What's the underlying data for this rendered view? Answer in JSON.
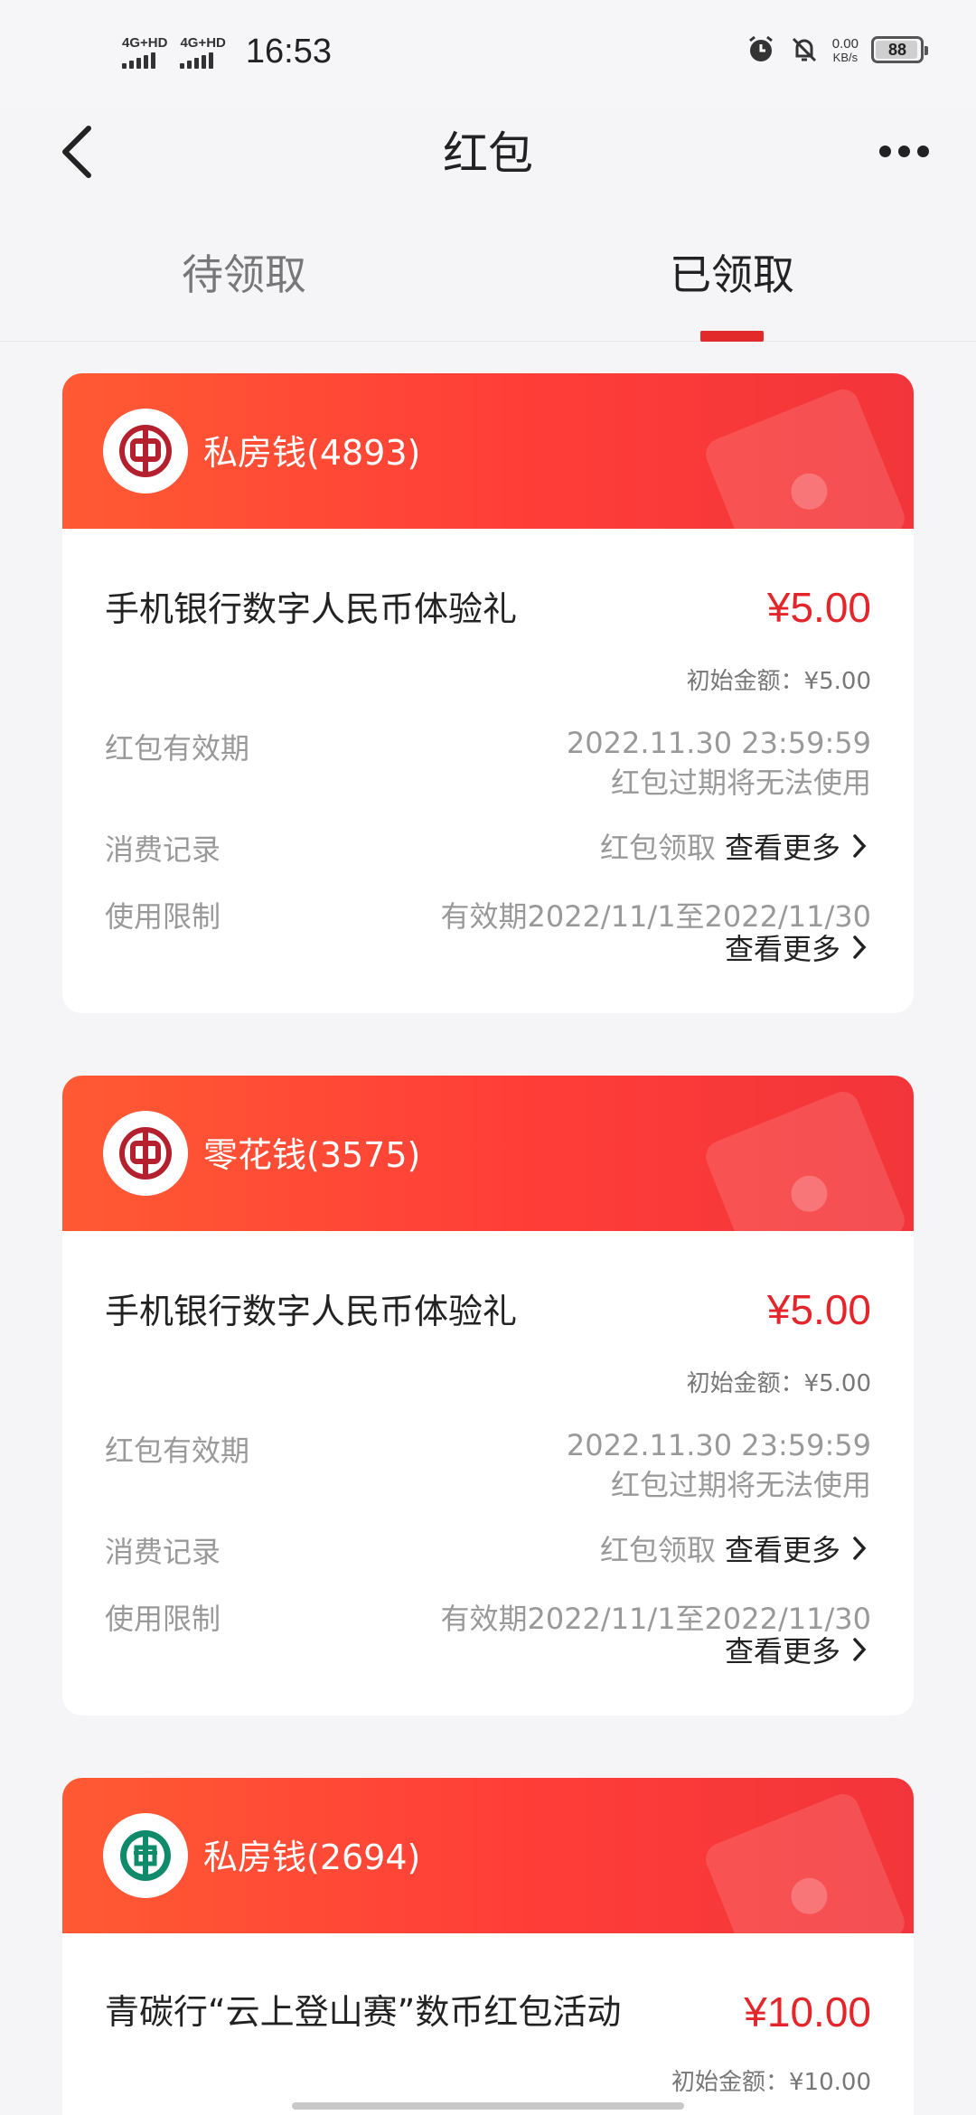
{
  "status_bar": {
    "network_1": "4G+HD",
    "network_2": "4G+HD",
    "time": "16:53",
    "speed_value": "0.00",
    "speed_unit": "KB/s",
    "battery": "88",
    "battery_level_percent": 88,
    "icons": [
      "alarm-icon",
      "mute-bell-icon"
    ]
  },
  "nav": {
    "title": "红包",
    "back_icon": "chevron-left-icon",
    "more_icon": "more-dots-icon"
  },
  "tabs": [
    {
      "label": "待领取",
      "active": false
    },
    {
      "label": "已领取",
      "active": true
    }
  ],
  "accent_color": "#e3262b",
  "cards": [
    {
      "logo_icon": "bank-of-china-logo",
      "header_label": "私房钱(4893)",
      "name": "手机银行数字人民币体验礼",
      "amount": "¥5.00",
      "initial_amount": "初始金额：¥5.00",
      "validity_label": "红包有效期",
      "validity_value": "2022.11.30 23:59:59",
      "validity_note": "红包过期将无法使用",
      "record_label": "消费记录",
      "record_value": "红包领取",
      "record_link": "查看更多",
      "limit_label": "使用限制",
      "limit_value": "有效期2022/11/1至2022/11/30",
      "limit_link": "查看更多"
    },
    {
      "logo_icon": "bank-of-china-logo",
      "header_label": "零花钱(3575)",
      "name": "手机银行数字人民币体验礼",
      "amount": "¥5.00",
      "initial_amount": "初始金额：¥5.00",
      "validity_label": "红包有效期",
      "validity_value": "2022.11.30 23:59:59",
      "validity_note": "红包过期将无法使用",
      "record_label": "消费记录",
      "record_value": "红包领取",
      "record_link": "查看更多",
      "limit_label": "使用限制",
      "limit_value": "有效期2022/11/1至2022/11/30",
      "limit_link": "查看更多"
    },
    {
      "logo_icon": "agricultural-bank-logo",
      "header_label": "私房钱(2694)",
      "name": "青碳行“云上登山赛”数币红包活动",
      "amount": "¥10.00",
      "initial_amount": "初始金额：¥10.00"
    }
  ]
}
